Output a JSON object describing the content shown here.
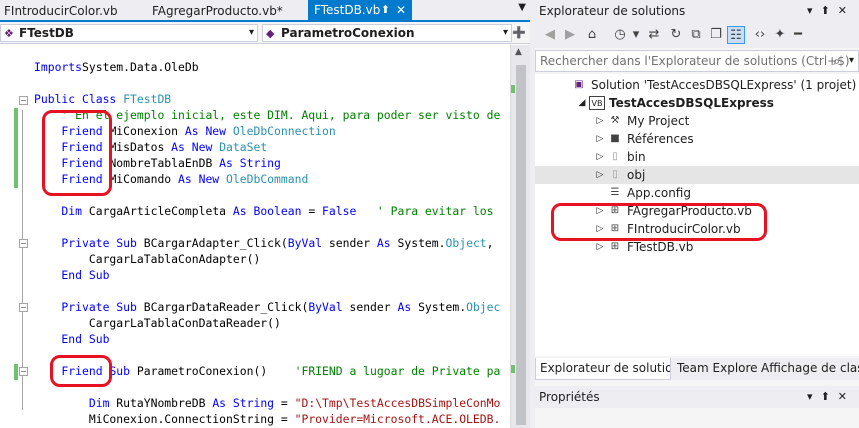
{
  "editor": {
    "tabs": [
      {
        "label": "FIntroducirColor.vb"
      },
      {
        "label": "FAgregarProducto.vb*"
      },
      {
        "label": "FTestDB.vb",
        "active": true
      }
    ],
    "nav_class": "FTestDB",
    "nav_member": "ParametroConexion",
    "code_lines": [
      {
        "tokens": [
          [
            "kw",
            "Imports"
          ],
          [
            "",
            "System.Data.OleDb"
          ]
        ]
      },
      {
        "tokens": []
      },
      {
        "tokens": [
          [
            "kw",
            "Public Class "
          ],
          [
            "ty",
            "FTestDB"
          ]
        ]
      },
      {
        "tokens": [
          [
            "cm",
            "    ' En el ejemplo inicial, este DIM. Aqui, para poder ser visto de"
          ]
        ]
      },
      {
        "tokens": [
          [
            "kw",
            "    Friend "
          ],
          [
            "",
            "MiConexion "
          ],
          [
            "kw",
            "As New "
          ],
          [
            "ty",
            "OleDbConnection"
          ]
        ]
      },
      {
        "tokens": [
          [
            "kw",
            "    Friend "
          ],
          [
            "",
            "MisDatos "
          ],
          [
            "kw",
            "As New "
          ],
          [
            "ty",
            "DataSet"
          ]
        ]
      },
      {
        "tokens": [
          [
            "kw",
            "    Friend "
          ],
          [
            "",
            "NombreTablaEnDB "
          ],
          [
            "kw",
            "As "
          ],
          [
            "kw",
            "String"
          ]
        ]
      },
      {
        "tokens": [
          [
            "kw",
            "    Friend "
          ],
          [
            "",
            "MiComando "
          ],
          [
            "kw",
            "As New "
          ],
          [
            "ty",
            "OleDbCommand"
          ]
        ]
      },
      {
        "tokens": []
      },
      {
        "tokens": [
          [
            "kw",
            "    Dim "
          ],
          [
            "",
            "CargaArticleCompleta "
          ],
          [
            "kw",
            "As Boolean"
          ],
          [
            "",
            " = "
          ],
          [
            "kw",
            "False"
          ],
          [
            "cm",
            "   ' Para evitar los"
          ]
        ]
      },
      {
        "tokens": []
      },
      {
        "tokens": [
          [
            "kw",
            "    Private Sub "
          ],
          [
            "",
            "BCargarAdapter_Click("
          ],
          [
            "kw",
            "ByVal "
          ],
          [
            "",
            "sender "
          ],
          [
            "kw",
            "As "
          ],
          [
            "",
            "System."
          ],
          [
            "ty",
            "Object"
          ],
          [
            "",
            ","
          ]
        ]
      },
      {
        "tokens": [
          [
            "",
            "        CargarLaTablaConAdapter()"
          ]
        ]
      },
      {
        "tokens": [
          [
            "kw",
            "    End Sub"
          ]
        ]
      },
      {
        "tokens": []
      },
      {
        "tokens": [
          [
            "kw",
            "    Private Sub "
          ],
          [
            "",
            "BCargarDataReader_Click("
          ],
          [
            "kw",
            "ByVal "
          ],
          [
            "",
            "sender "
          ],
          [
            "kw",
            "As "
          ],
          [
            "",
            "System."
          ],
          [
            "ty",
            "Objec"
          ]
        ]
      },
      {
        "tokens": [
          [
            "",
            "        CargarLaTablaConDataReader()"
          ]
        ]
      },
      {
        "tokens": [
          [
            "kw",
            "    End Sub"
          ]
        ]
      },
      {
        "tokens": []
      },
      {
        "tokens": [
          [
            "kw",
            "    Friend "
          ],
          [
            "kw",
            "Sub "
          ],
          [
            "",
            "ParametroConexion()    "
          ],
          [
            "cm",
            "'FRIEND a lugoar de Private pa"
          ]
        ]
      },
      {
        "tokens": []
      },
      {
        "tokens": [
          [
            "kw",
            "        Dim "
          ],
          [
            "",
            "RutaYNombreDB "
          ],
          [
            "kw",
            "As String"
          ],
          [
            "",
            " = "
          ],
          [
            "st",
            "\"D:\\Tmp\\TestAccesDBSimpleConMo"
          ]
        ]
      },
      {
        "tokens": [
          [
            "",
            "        MiConexion.ConnectionString = "
          ],
          [
            "st",
            "\"Provider=Microsoft.ACE.OLEDB."
          ]
        ]
      }
    ]
  },
  "solution_explorer": {
    "title": "Explorateur de solutions",
    "search_placeholder": "Rechercher dans l'Explorateur de solutions (Ctrl+$)",
    "tree": [
      {
        "label": "Solution 'TestAccesDBSQLExpress' (1 projet)",
        "icon": "solution-icon",
        "indent": 0,
        "expander": ""
      },
      {
        "label": "TestAccesDBSQLExpress",
        "icon": "vb-project-icon",
        "indent": 1,
        "expander": "open",
        "bold": true
      },
      {
        "label": "My Project",
        "icon": "wrench-icon",
        "indent": 2,
        "expander": "closed"
      },
      {
        "label": "Références",
        "icon": "references-icon",
        "indent": 2,
        "expander": "closed"
      },
      {
        "label": "bin",
        "icon": "folder-icon",
        "indent": 2,
        "expander": "closed"
      },
      {
        "label": "obj",
        "icon": "folder-icon",
        "indent": 2,
        "expander": "closed",
        "selected": true
      },
      {
        "label": "App.config",
        "icon": "config-icon",
        "indent": 2,
        "expander": ""
      },
      {
        "label": "FAgregarProducto.vb",
        "icon": "form-icon",
        "indent": 2,
        "expander": "closed"
      },
      {
        "label": "FIntroducirColor.vb",
        "icon": "form-icon",
        "indent": 2,
        "expander": "closed"
      },
      {
        "label": "FTestDB.vb",
        "icon": "form-icon",
        "indent": 2,
        "expander": "closed"
      }
    ],
    "bottom_tabs": [
      "Explorateur de solutions",
      "Team Explorer",
      "Affichage de classe"
    ],
    "properties_title": "Propriétés"
  },
  "colors": {
    "accent": "#007acc",
    "highlight": "#e81123",
    "change_marker": "#6fc36f"
  }
}
